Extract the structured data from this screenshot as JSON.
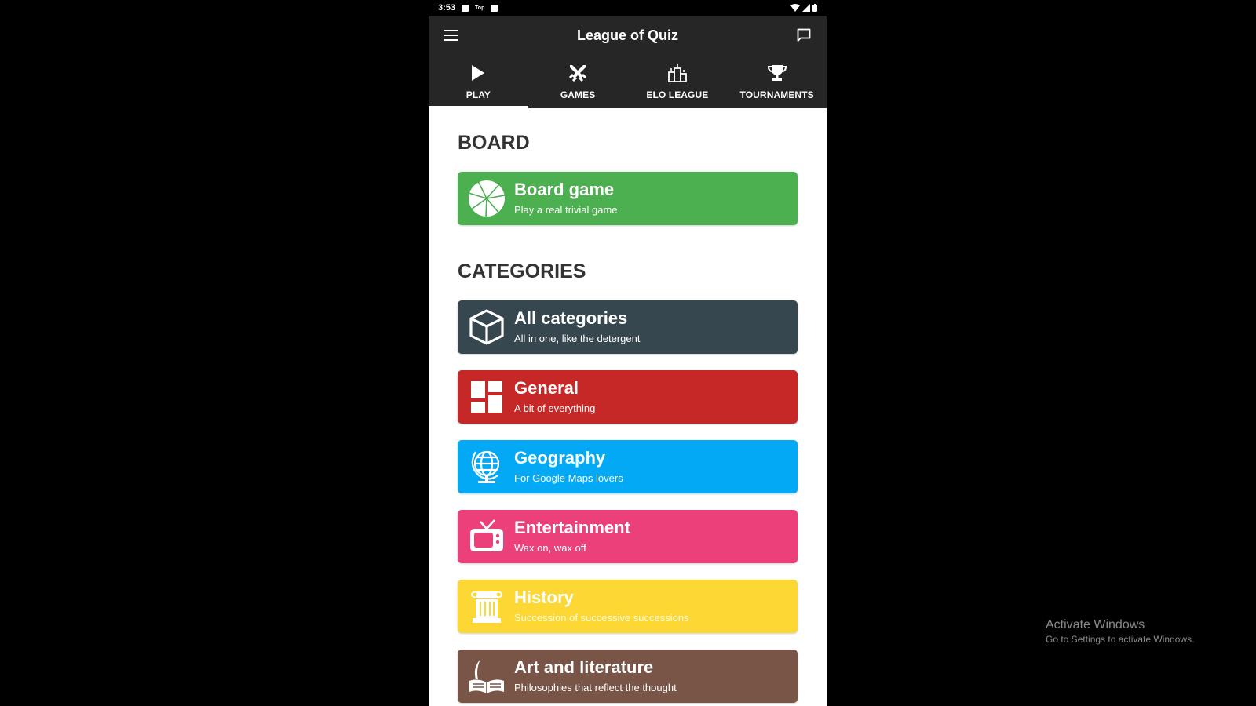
{
  "status_bar": {
    "time": "3:53",
    "left_icons": [
      "image-icon",
      "app-notification-icon",
      "download-icon"
    ],
    "notification_text": "Top",
    "right_icons": [
      "wifi-icon",
      "signal-icon",
      "battery-icon"
    ]
  },
  "toolbar": {
    "title": "League of Quiz",
    "menu_icon": "hamburger-menu-icon",
    "chat_icon": "chat-bubble-icon"
  },
  "tabs": [
    {
      "label": "PLAY",
      "icon": "play-icon",
      "active": true
    },
    {
      "label": "GAMES",
      "icon": "crossed-swords-icon",
      "active": false
    },
    {
      "label": "ELO LEAGUE",
      "icon": "podium-icon",
      "active": false
    },
    {
      "label": "TOURNAMENTS",
      "icon": "trophy-icon",
      "active": false
    }
  ],
  "board": {
    "section_title": "BOARD",
    "card": {
      "title": "Board game",
      "subtitle": "Play a real trivial game",
      "icon": "pie-wheel-icon",
      "color": "#4CAF50"
    }
  },
  "categories": {
    "section_title": "CATEGORIES",
    "items": [
      {
        "title": "All categories",
        "subtitle": "All in one, like the detergent",
        "icon": "cube-icon",
        "color": "#37474F"
      },
      {
        "title": "General",
        "subtitle": "A bit of everything",
        "icon": "grid-blocks-icon",
        "color": "#C62828"
      },
      {
        "title": "Geography",
        "subtitle": "For Google Maps lovers",
        "icon": "globe-icon",
        "color": "#03A9F4"
      },
      {
        "title": "Entertainment",
        "subtitle": "Wax on, wax off",
        "icon": "tv-icon",
        "color": "#EC407A"
      },
      {
        "title": "History",
        "subtitle": "Succession of successive successions",
        "icon": "column-icon",
        "color": "#FDD835"
      },
      {
        "title": "Art and literature",
        "subtitle": "Philosophies that reflect the thought",
        "icon": "quill-book-icon",
        "color": "#795548"
      }
    ]
  },
  "watermark": {
    "title": "Activate Windows",
    "subtitle": "Go to Settings to activate Windows."
  }
}
